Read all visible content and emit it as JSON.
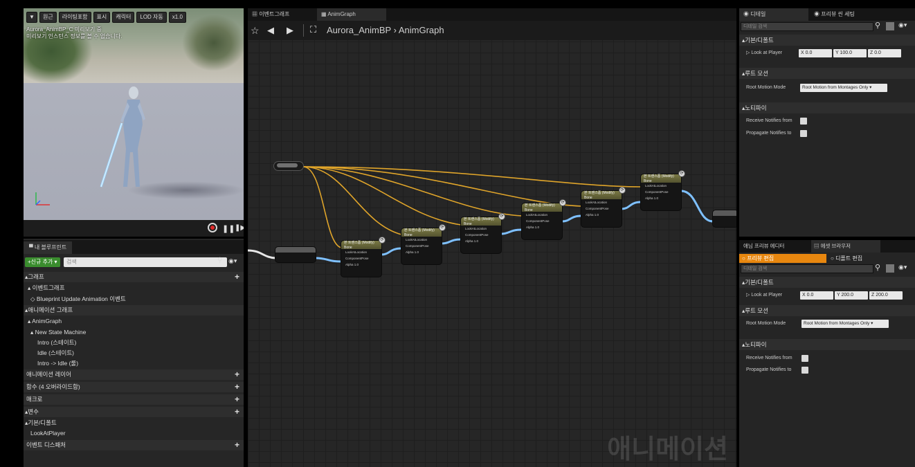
{
  "viewport": {
    "toolbar": [
      "▼",
      "원근",
      "라이팅포함",
      "표시",
      "캐릭터",
      "LOD 자동",
      "x1.0"
    ],
    "info_line1": "Aurora_AnimBP_C 미리보기 중",
    "info_line2": "미리보기 인스턴스 정보를 볼 수 없습니다."
  },
  "my_blueprint": {
    "tab_label": "내 블루프린트",
    "add_new_label": "+신규 추가 ▾",
    "search_placeholder": "검색",
    "rows": [
      {
        "label": "▴그래프",
        "section": true,
        "plus": true
      },
      {
        "label": "▴ 이벤트그래프",
        "section": false,
        "plus": false
      },
      {
        "label": "◇ Blueprint Update Animation 이벤트",
        "section": false,
        "plus": false
      },
      {
        "label": "▴애니메이션 그래프",
        "section": true,
        "plus": false
      },
      {
        "label": "▴ AnimGraph",
        "section": false,
        "plus": false
      },
      {
        "label": "▴ New State Machine",
        "section": false,
        "plus": false
      },
      {
        "label": "Intro (스테이트)",
        "section": false,
        "plus": false
      },
      {
        "label": "Idle (스테이트)",
        "section": false,
        "plus": false
      },
      {
        "label": "Intro -> Idle (룰)",
        "section": false,
        "plus": false
      },
      {
        "label": "애니메이션 레이어",
        "section": true,
        "plus": true
      },
      {
        "label": "함수 (4 오버라이드함)",
        "section": true,
        "plus": true
      },
      {
        "label": "매크로",
        "section": true,
        "plus": true
      },
      {
        "label": "▴변수",
        "section": true,
        "plus": true
      },
      {
        "label": "▴기본/디폴트",
        "section": false,
        "plus": false
      },
      {
        "label": "LookAtPlayer",
        "section": false,
        "plus": false
      },
      {
        "label": "이벤트 디스패처",
        "section": true,
        "plus": true
      }
    ]
  },
  "graph": {
    "tabs": [
      "이벤트그래프",
      "AnimGraph"
    ],
    "breadcrumb_root": "Aurora_AnimBP",
    "breadcrumb_sep": "›",
    "breadcrumb_current": "AnimGraph",
    "watermark": "애니메이션",
    "node_title": "본 트랜스폼 (Modify) Bone",
    "pins": [
      "LookAtLocation",
      "ComponentPose",
      "Alpha 1.0"
    ]
  },
  "details": {
    "tabs": [
      "디테일",
      "프리뷰 씬 세팅"
    ],
    "search_placeholder": "디테일 검색",
    "sect_default": "▴기본/디폴트",
    "look_at_label": "▷ Look at Player",
    "look_at": {
      "x": "X 0.0",
      "y": "Y 100.0",
      "z": "Z 0.0"
    },
    "sect_root": "▴루트 모션",
    "root_motion_label": "Root Motion Mode",
    "root_motion_value": "Root Motion from Montages Only ▾",
    "sect_notify": "▴노티파이",
    "receive_label": "Receive Notifies from",
    "propagate_label": "Propagate Notifies to"
  },
  "preview": {
    "tabs": [
      "애님 프리뷰 에디터",
      "에셋 브라우저"
    ],
    "subtab_active": "프리뷰 편집",
    "subtab_other": "디폴트 편집",
    "search_placeholder": "디테일 검색",
    "sect_default": "▴기본/디폴트",
    "look_at_label": "▷ Look at Player",
    "look_at": {
      "x": "X 0.0",
      "y": "Y 200.0",
      "z": "Z 200.0"
    },
    "sect_root": "▴루트 모션",
    "root_motion_label": "Root Motion Mode",
    "root_motion_value": "Root Motion from Montages Only ▾",
    "sect_notify": "▴노티파이",
    "receive_label": "Receive Notifies from",
    "propagate_label": "Propagate Notifies to"
  },
  "colors": {
    "accent_orange": "#e8870f",
    "wire_exec": "#e0a52a",
    "wire_pose": "#7ec0ff",
    "add_green": "#3a8d2e"
  }
}
